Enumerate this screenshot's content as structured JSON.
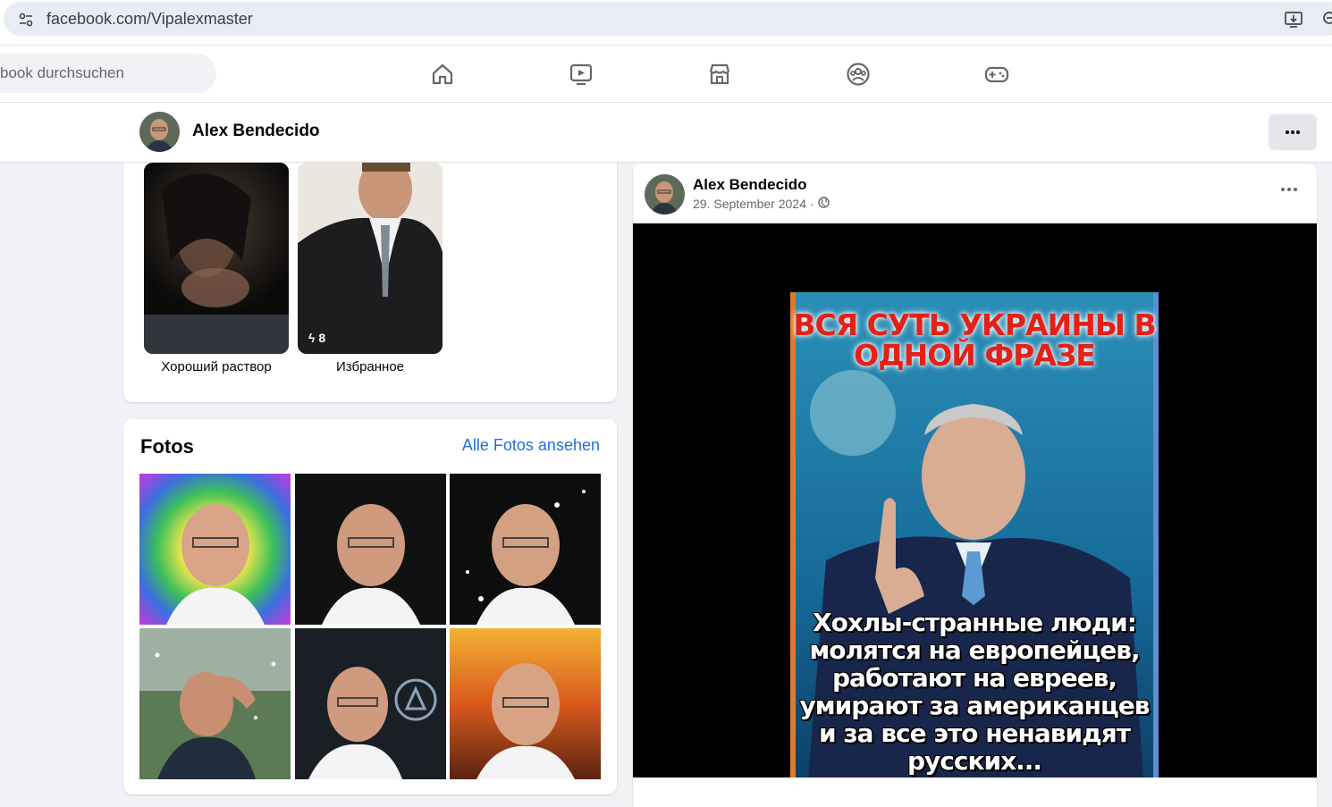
{
  "browser": {
    "url": "facebook.com/Vipalexmaster"
  },
  "nav": {
    "search_placeholder": "book durchsuchen",
    "icons": [
      "home-icon",
      "video-icon",
      "marketplace-icon",
      "groups-icon",
      "gaming-icon"
    ]
  },
  "profile": {
    "name": "Alex Bendecido"
  },
  "highlights": [
    {
      "label": "Хороший раствор"
    },
    {
      "label": "Избранное",
      "count": "8"
    }
  ],
  "photos": {
    "title": "Fotos",
    "see_all": "Alle Fotos ansehen"
  },
  "post": {
    "author": "Alex Bendecido",
    "date": "29. September 2024",
    "separator": "·",
    "image_headline": "ВСЯ СУТЬ УКРАИНЫ В ОДНОЙ ФРАЗЕ",
    "image_body": "Хохлы-странные люди: молятся на европейцев, работают на евреев, умирают за американцев и за все это ненавидят русских..."
  },
  "colors": {
    "link": "#216fdb",
    "page_bg": "#f0f2f5",
    "nav_icon": "#65676b"
  }
}
